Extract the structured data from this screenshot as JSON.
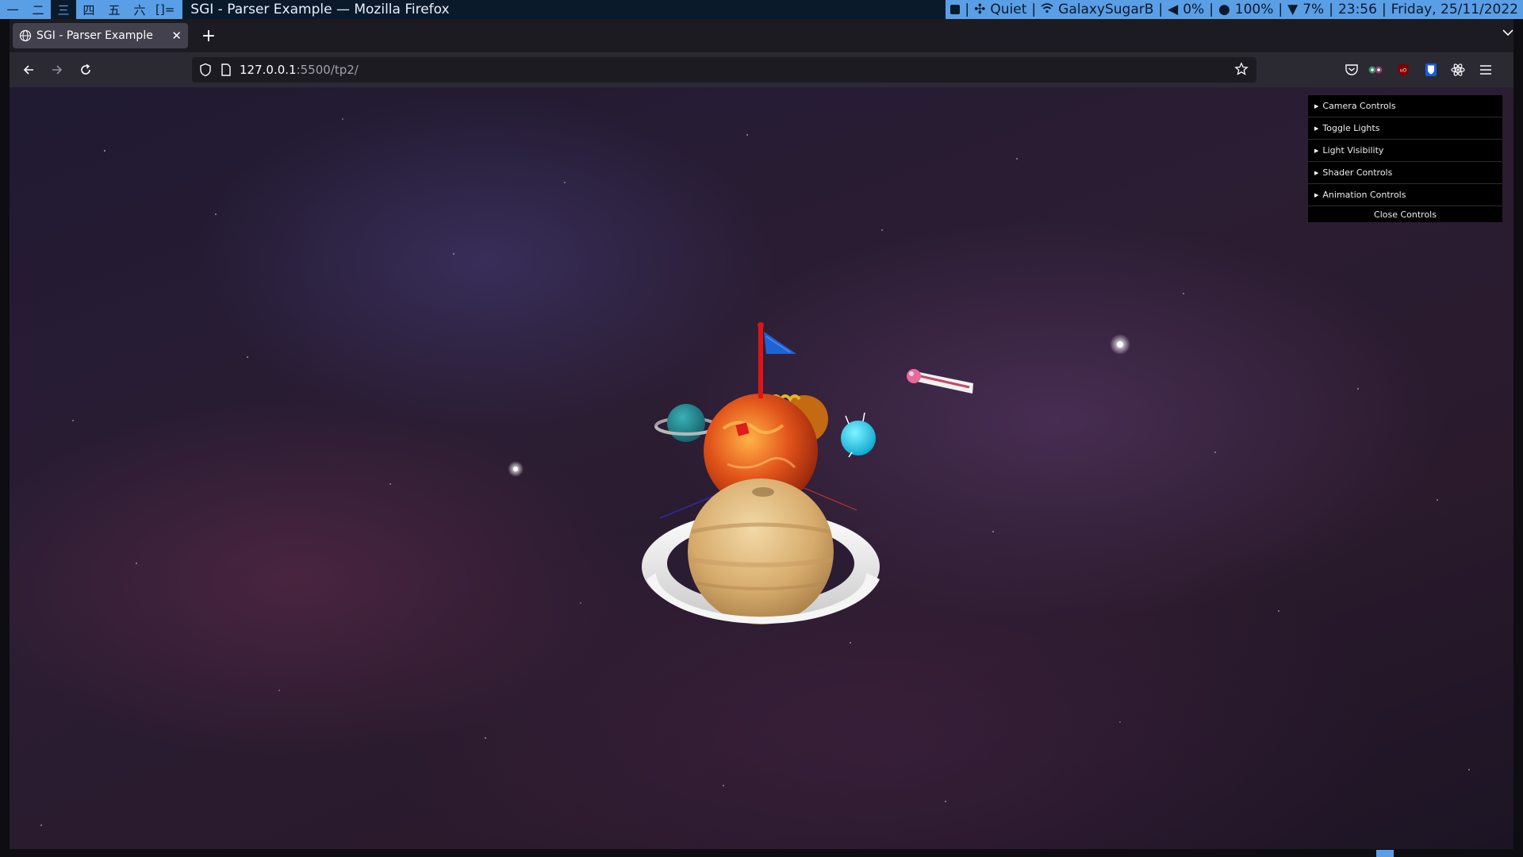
{
  "wm": {
    "workspaces": [
      {
        "label": "一",
        "active": false
      },
      {
        "label": "二",
        "active": false
      },
      {
        "label": "三",
        "active": true
      },
      {
        "label": "四",
        "active": false
      },
      {
        "label": "五",
        "active": false
      },
      {
        "label": "六",
        "active": false
      }
    ],
    "layout": "[]=",
    "window_title": "SGI - Parser Example — Mozilla Firefox",
    "status": {
      "mode": "Quiet",
      "wifi": "GalaxySugarB",
      "volume": "0%",
      "brightness": "100%",
      "battery": "7%",
      "time": "23:56",
      "date": "Friday, 25/11/2022"
    }
  },
  "browser": {
    "tab_title": "SGI - Parser Example",
    "url_host": "127.0.0.1",
    "url_path": ":5500/tp2/"
  },
  "gui": {
    "folders": [
      "Camera Controls",
      "Toggle Lights",
      "Light Visibility",
      "Shader Controls",
      "Animation Controls"
    ],
    "close_label": "Close Controls"
  },
  "colors": {
    "wm_accent": "#5a9ee6",
    "wm_dark": "#0b1a2b",
    "browser_tab": "#42414d",
    "browser_nav": "#2b2a33"
  }
}
